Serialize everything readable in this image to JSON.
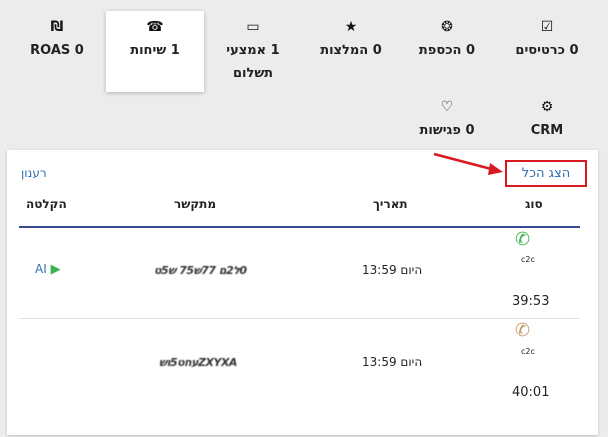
{
  "tabs": [
    {
      "icon": "☑",
      "icon_name": "calendar-check-icon",
      "label": "0 כרטיסים"
    },
    {
      "icon": "❂",
      "icon_name": "coins-icon",
      "label": "0 הכספת"
    },
    {
      "icon": "★",
      "icon_name": "star-icon",
      "label": "0 המלצות"
    },
    {
      "icon": "▭",
      "icon_name": "credit-card-icon",
      "label": "1 אמצעי תשלום"
    },
    {
      "icon": "☎",
      "icon_name": "phone-icon",
      "label": "1 שיחות",
      "active": true
    },
    {
      "icon": "₪",
      "icon_name": "shekel-icon",
      "label": "ROAS 0"
    },
    {
      "icon": "⚙",
      "icon_name": "gear-icon",
      "label": "CRM"
    },
    {
      "icon": "♡",
      "icon_name": "handshake-icon",
      "label": "0 פגישות"
    }
  ],
  "panel": {
    "show_all": "הצג הכל",
    "refresh": "רענון",
    "columns": {
      "type": "סוג",
      "date": "תאריך",
      "caller": "מתקשר",
      "recording": "הקלטה"
    },
    "rows": [
      {
        "type": "c2c",
        "duration": "39:53",
        "date": "היום 13:59",
        "caller": "0ל2ם 77ש75 ש5ט",
        "recording": "AI",
        "phone_color": "#3cb34a"
      },
      {
        "type": "c2c",
        "duration": "40:01",
        "date": "היום 13:59",
        "caller": "ZXYXAעחט5וש",
        "recording": "",
        "phone_color": "#c49a6c"
      }
    ]
  },
  "colors": {
    "accent": "#2f6db5",
    "highlight": "#d71920",
    "header_rule": "#3a4a90"
  }
}
